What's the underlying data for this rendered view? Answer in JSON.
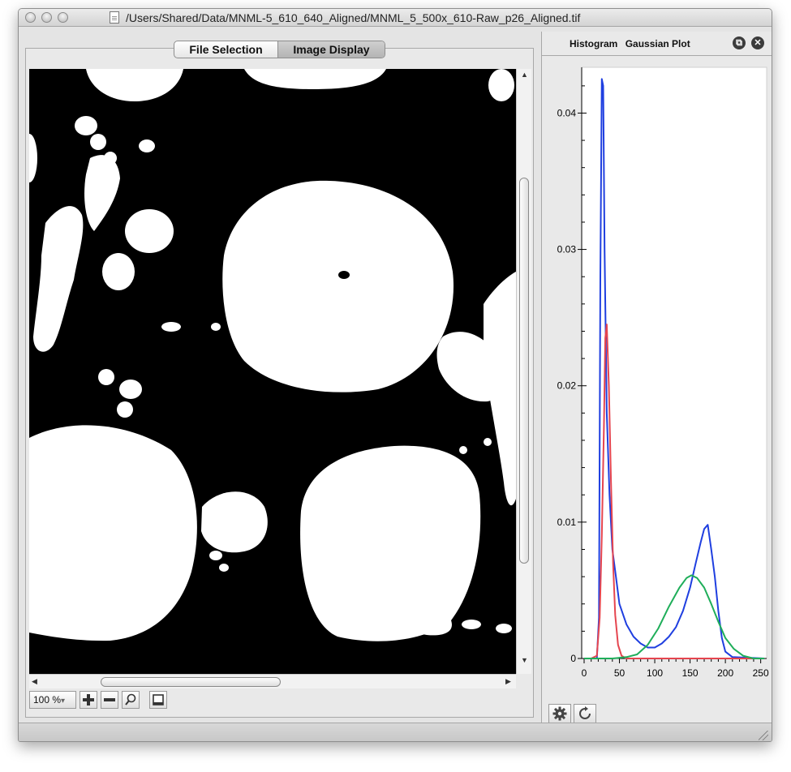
{
  "window": {
    "title": "/Users/Shared/Data/MNML-5_610_640_Aligned/MNML_5_500x_610-Raw_p26_Aligned.tif"
  },
  "tabs": [
    {
      "label": "File Selection",
      "selected": false
    },
    {
      "label": "Image Display",
      "selected": true
    }
  ],
  "image_display": {
    "zoom_value": "100 %",
    "zoom_arrow": "▾",
    "colors": {
      "background": "#000000",
      "foreground": "#ffffff"
    }
  },
  "right_panel": {
    "tabs": [
      "Histogram",
      "Gaussian Plot"
    ],
    "buttons": {
      "settings_icon": "gear-icon",
      "refresh_icon": "refresh-icon"
    }
  },
  "chart_data": {
    "type": "line",
    "title": "",
    "xlabel": "",
    "ylabel": "",
    "xlim": [
      0,
      255
    ],
    "ylim": [
      0,
      0.043
    ],
    "x_ticks": [
      0,
      50,
      100,
      150,
      200,
      250
    ],
    "y_ticks": [
      "0",
      "0.01",
      "0.02",
      "0.03",
      "0.04"
    ],
    "series": [
      {
        "color": "#1f3fe0",
        "points": [
          [
            0,
            0
          ],
          [
            10,
            0
          ],
          [
            18,
            0
          ],
          [
            21,
            0.003
          ],
          [
            23,
            0.028
          ],
          [
            25,
            0.0425
          ],
          [
            27,
            0.042
          ],
          [
            29,
            0.03
          ],
          [
            32,
            0.018
          ],
          [
            36,
            0.012
          ],
          [
            40,
            0.008
          ],
          [
            45,
            0.006
          ],
          [
            50,
            0.004
          ],
          [
            60,
            0.0025
          ],
          [
            70,
            0.0016
          ],
          [
            80,
            0.0011
          ],
          [
            90,
            0.0008
          ],
          [
            100,
            0.0008
          ],
          [
            110,
            0.0011
          ],
          [
            120,
            0.0016
          ],
          [
            130,
            0.0023
          ],
          [
            140,
            0.0035
          ],
          [
            150,
            0.0052
          ],
          [
            158,
            0.007
          ],
          [
            165,
            0.0085
          ],
          [
            170,
            0.0095
          ],
          [
            175,
            0.0098
          ],
          [
            180,
            0.008
          ],
          [
            185,
            0.006
          ],
          [
            190,
            0.0035
          ],
          [
            195,
            0.0015
          ],
          [
            200,
            0.0005
          ],
          [
            210,
            0.0001
          ],
          [
            255,
            0
          ]
        ]
      },
      {
        "color": "#e5454f",
        "points": [
          [
            0,
            0
          ],
          [
            10,
            0
          ],
          [
            18,
            0.0002
          ],
          [
            22,
            0.003
          ],
          [
            25,
            0.009
          ],
          [
            28,
            0.017
          ],
          [
            30,
            0.0235
          ],
          [
            32,
            0.0245
          ],
          [
            35,
            0.02
          ],
          [
            38,
            0.013
          ],
          [
            41,
            0.007
          ],
          [
            44,
            0.0032
          ],
          [
            48,
            0.001
          ],
          [
            53,
            0.0002
          ],
          [
            60,
            0
          ],
          [
            255,
            0
          ]
        ]
      },
      {
        "color": "#1fae5a",
        "points": [
          [
            0,
            0
          ],
          [
            40,
            0
          ],
          [
            60,
            0.0001
          ],
          [
            75,
            0.0003
          ],
          [
            90,
            0.001
          ],
          [
            105,
            0.0022
          ],
          [
            120,
            0.0038
          ],
          [
            135,
            0.0052
          ],
          [
            145,
            0.0059
          ],
          [
            152,
            0.0061
          ],
          [
            160,
            0.0059
          ],
          [
            170,
            0.0052
          ],
          [
            180,
            0.004
          ],
          [
            190,
            0.0027
          ],
          [
            200,
            0.0015
          ],
          [
            212,
            0.0007
          ],
          [
            225,
            0.0002
          ],
          [
            240,
            0
          ],
          [
            255,
            0
          ]
        ]
      }
    ]
  }
}
